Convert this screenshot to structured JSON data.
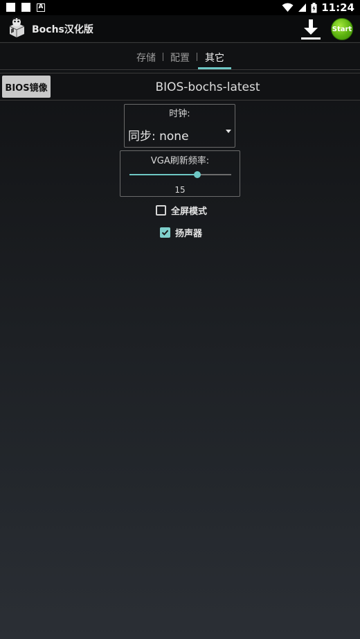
{
  "status_bar": {
    "time": "11:24",
    "icons": [
      "notification-square-icon",
      "notification-square-icon",
      "a-notification-icon",
      "wifi-icon",
      "signal-icon",
      "battery-icon"
    ]
  },
  "app_bar": {
    "title": "Bochs汉化版",
    "start_label": "Start",
    "download_icon": "download-icon"
  },
  "tabs": [
    {
      "label": "存储",
      "active": false
    },
    {
      "label": "配置",
      "active": false
    },
    {
      "label": "其它",
      "active": true
    }
  ],
  "bios": {
    "button_label": "BIOS镜像",
    "selected_image": "BIOS-bochs-latest"
  },
  "clock": {
    "label": "时钟:",
    "value": "同步: none"
  },
  "vga": {
    "label": "VGA刷新频率:",
    "value": "15",
    "slider_fraction": 0.67
  },
  "options": [
    {
      "label": "全屏模式",
      "checked": false
    },
    {
      "label": "扬声器",
      "checked": true
    }
  ],
  "colors": {
    "accent": "#6ec8c5",
    "start_green": "#5bb10f",
    "background": "#17191c"
  }
}
